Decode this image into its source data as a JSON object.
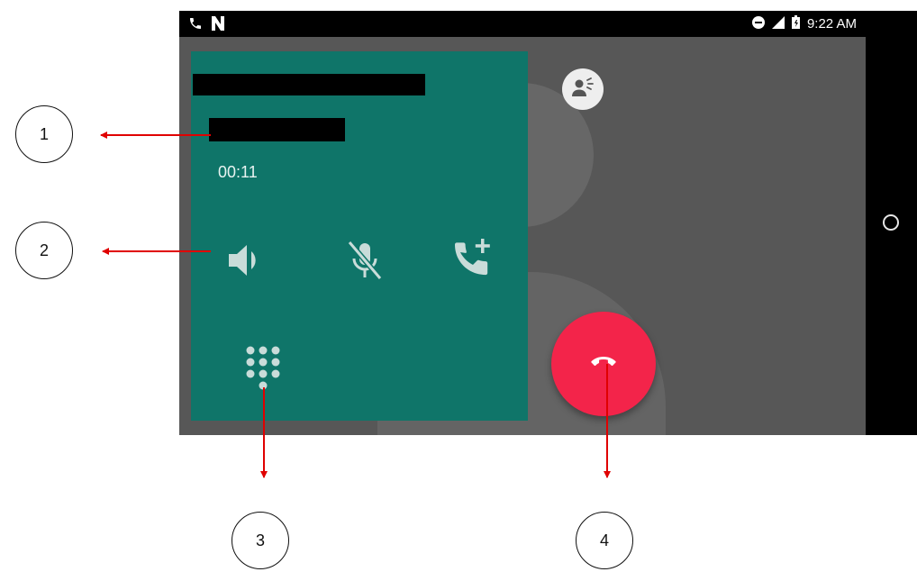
{
  "status_bar": {
    "time": "9:22 AM",
    "icons": [
      "phone-icon",
      "nfc-icon",
      "dnd-icon",
      "signal-icon",
      "battery-icon"
    ]
  },
  "call": {
    "timer": "00:11"
  },
  "controls": {
    "speaker": "speaker-icon",
    "mute": "mic-off-icon",
    "add_call": "add-call-icon",
    "dialpad": "dialpad-icon",
    "end_call": "call-end-icon"
  },
  "annotations": {
    "n1": "1",
    "n2": "2",
    "n3": "3",
    "n4": "4"
  },
  "colors": {
    "card": "#0f7569",
    "end_call": "#f3244a",
    "arrow": "#e00000",
    "screen_bg": "#575757"
  }
}
